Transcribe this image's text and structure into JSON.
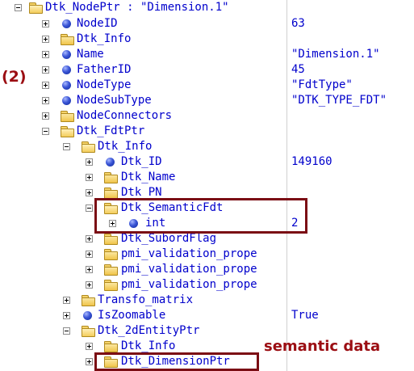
{
  "annotations": {
    "label_2": "(2)",
    "semantic": "semantic data"
  },
  "rows": [
    {
      "label": "Dtk_NodePtr : \"Dimension.1\"",
      "value": ""
    },
    {
      "label": "NodeID",
      "value": "63"
    },
    {
      "label": "Dtk_Info",
      "value": ""
    },
    {
      "label": "Name",
      "value": "\"Dimension.1\""
    },
    {
      "label": "FatherID",
      "value": "45"
    },
    {
      "label": "NodeType",
      "value": "\"FdtType\""
    },
    {
      "label": "NodeSubType",
      "value": "\"DTK_TYPE_FDT\""
    },
    {
      "label": "NodeConnectors",
      "value": ""
    },
    {
      "label": "Dtk_FdtPtr",
      "value": ""
    },
    {
      "label": "Dtk_Info",
      "value": ""
    },
    {
      "label": "Dtk_ID",
      "value": "149160"
    },
    {
      "label": "Dtk_Name",
      "value": ""
    },
    {
      "label": "Dtk_PN",
      "value": ""
    },
    {
      "label": "Dtk_SemanticFdt",
      "value": ""
    },
    {
      "label": "int",
      "value": "2"
    },
    {
      "label": "Dtk_SubordFlag",
      "value": ""
    },
    {
      "label": "pmi_validation_prope",
      "value": ""
    },
    {
      "label": "pmi_validation_prope",
      "value": ""
    },
    {
      "label": "pmi_validation_prope",
      "value": ""
    },
    {
      "label": "Transfo_matrix",
      "value": ""
    },
    {
      "label": "IsZoomable",
      "value": "True"
    },
    {
      "label": "Dtk_2dEntityPtr",
      "value": ""
    },
    {
      "label": "Dtk_Info",
      "value": ""
    },
    {
      "label": "Dtk_DimensionPtr",
      "value": ""
    }
  ]
}
